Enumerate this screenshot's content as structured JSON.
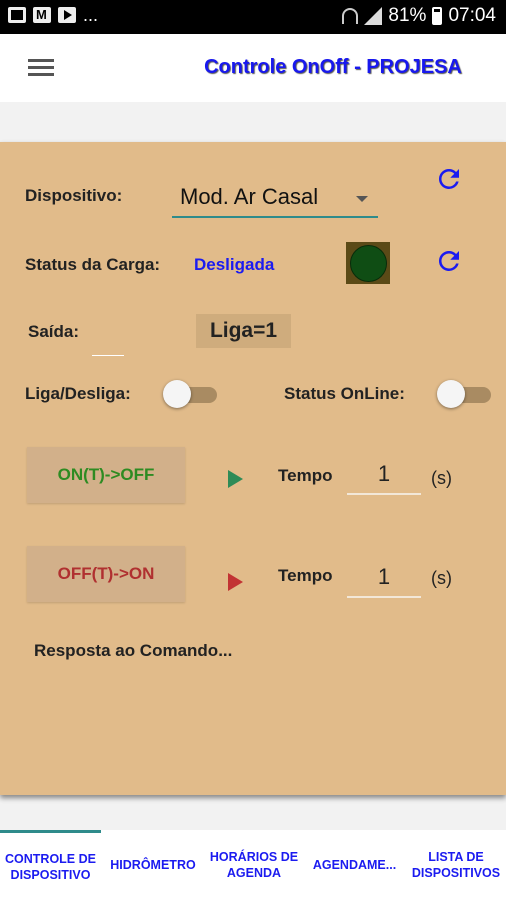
{
  "status_bar": {
    "battery": "81%",
    "time": "07:04",
    "dots": "..."
  },
  "app": {
    "title": "Controle OnOff - PROJESA"
  },
  "device": {
    "label": "Dispositivo:",
    "selected": "Mod. Ar  Casal"
  },
  "load_status": {
    "label": "Status da Carga:",
    "value": "Desligada"
  },
  "output": {
    "label": "Saída:",
    "value": "Liga=1"
  },
  "switches": {
    "onoff_label": "Liga/Desliga:",
    "online_label": "Status OnLine:",
    "onoff_on": false,
    "online_on": false
  },
  "timer_on_off": {
    "button": "ON(T)->OFF",
    "tempo_label": "Tempo",
    "value": "1",
    "unit": "(s)",
    "color": "#2e8b57"
  },
  "timer_off_on": {
    "button": "OFF(T)->ON",
    "tempo_label": "Tempo",
    "value": "1",
    "unit": "(s)",
    "color": "#c23333"
  },
  "response": {
    "text": "Resposta ao Comando..."
  },
  "tabs": [
    {
      "line1": "CONTROLE DE",
      "line2": "DISPOSITIVO",
      "active": true
    },
    {
      "line1": "HIDRÔMETRO",
      "line2": ""
    },
    {
      "line1": "HORÁRIOS DE",
      "line2": "AGENDA"
    },
    {
      "line1": "AGENDAME...",
      "line2": ""
    },
    {
      "line1": "LISTA DE",
      "line2": "DISPOSITIVOS"
    }
  ],
  "colors": {
    "panel": "#e1bb8a",
    "accent_blue": "#1b1bf0",
    "led": "#0f4d14"
  }
}
